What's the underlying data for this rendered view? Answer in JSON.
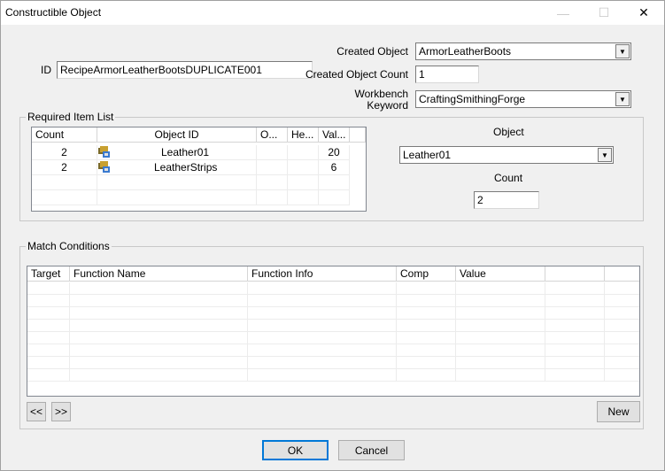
{
  "window": {
    "title": "Constructible Object",
    "minimize_glyph": "—",
    "maximize_glyph": "☐",
    "close_glyph": "✕"
  },
  "form": {
    "id_label": "ID",
    "id_value": "RecipeArmorLeatherBootsDUPLICATE001",
    "created_object_label": "Created Object",
    "created_object_value": "ArmorLeatherBoots",
    "created_count_label": "Created Object Count",
    "created_count_value": "1",
    "workbench_label_line1": "Workbench",
    "workbench_label_line2": "Keyword",
    "workbench_value": "CraftingSmithingForge"
  },
  "required_items": {
    "group_label": "Required Item List",
    "columns": [
      "Count",
      "Object ID",
      "O...",
      "He...",
      "Val..."
    ],
    "rows": [
      {
        "count": "2",
        "icon": "inventory-item-icon",
        "object_id": "Leather01",
        "o": "",
        "he": "",
        "val": "20"
      },
      {
        "count": "2",
        "icon": "inventory-item-icon",
        "object_id": "LeatherStrips",
        "o": "",
        "he": "",
        "val": "6"
      }
    ],
    "object_label": "Object",
    "object_value": "Leather01",
    "count_label": "Count",
    "count_value": "2"
  },
  "match_conditions": {
    "group_label": "Match Conditions",
    "columns": [
      "Target",
      "Function Name",
      "Function Info",
      "Comp",
      "Value",
      "",
      ""
    ],
    "prev_label": "<<",
    "next_label": ">>",
    "new_label": "New"
  },
  "buttons": {
    "ok_label": "OK",
    "cancel_label": "Cancel"
  },
  "colors": {
    "window_bg": "#f0f0f0",
    "focus_border": "#0078d7"
  }
}
